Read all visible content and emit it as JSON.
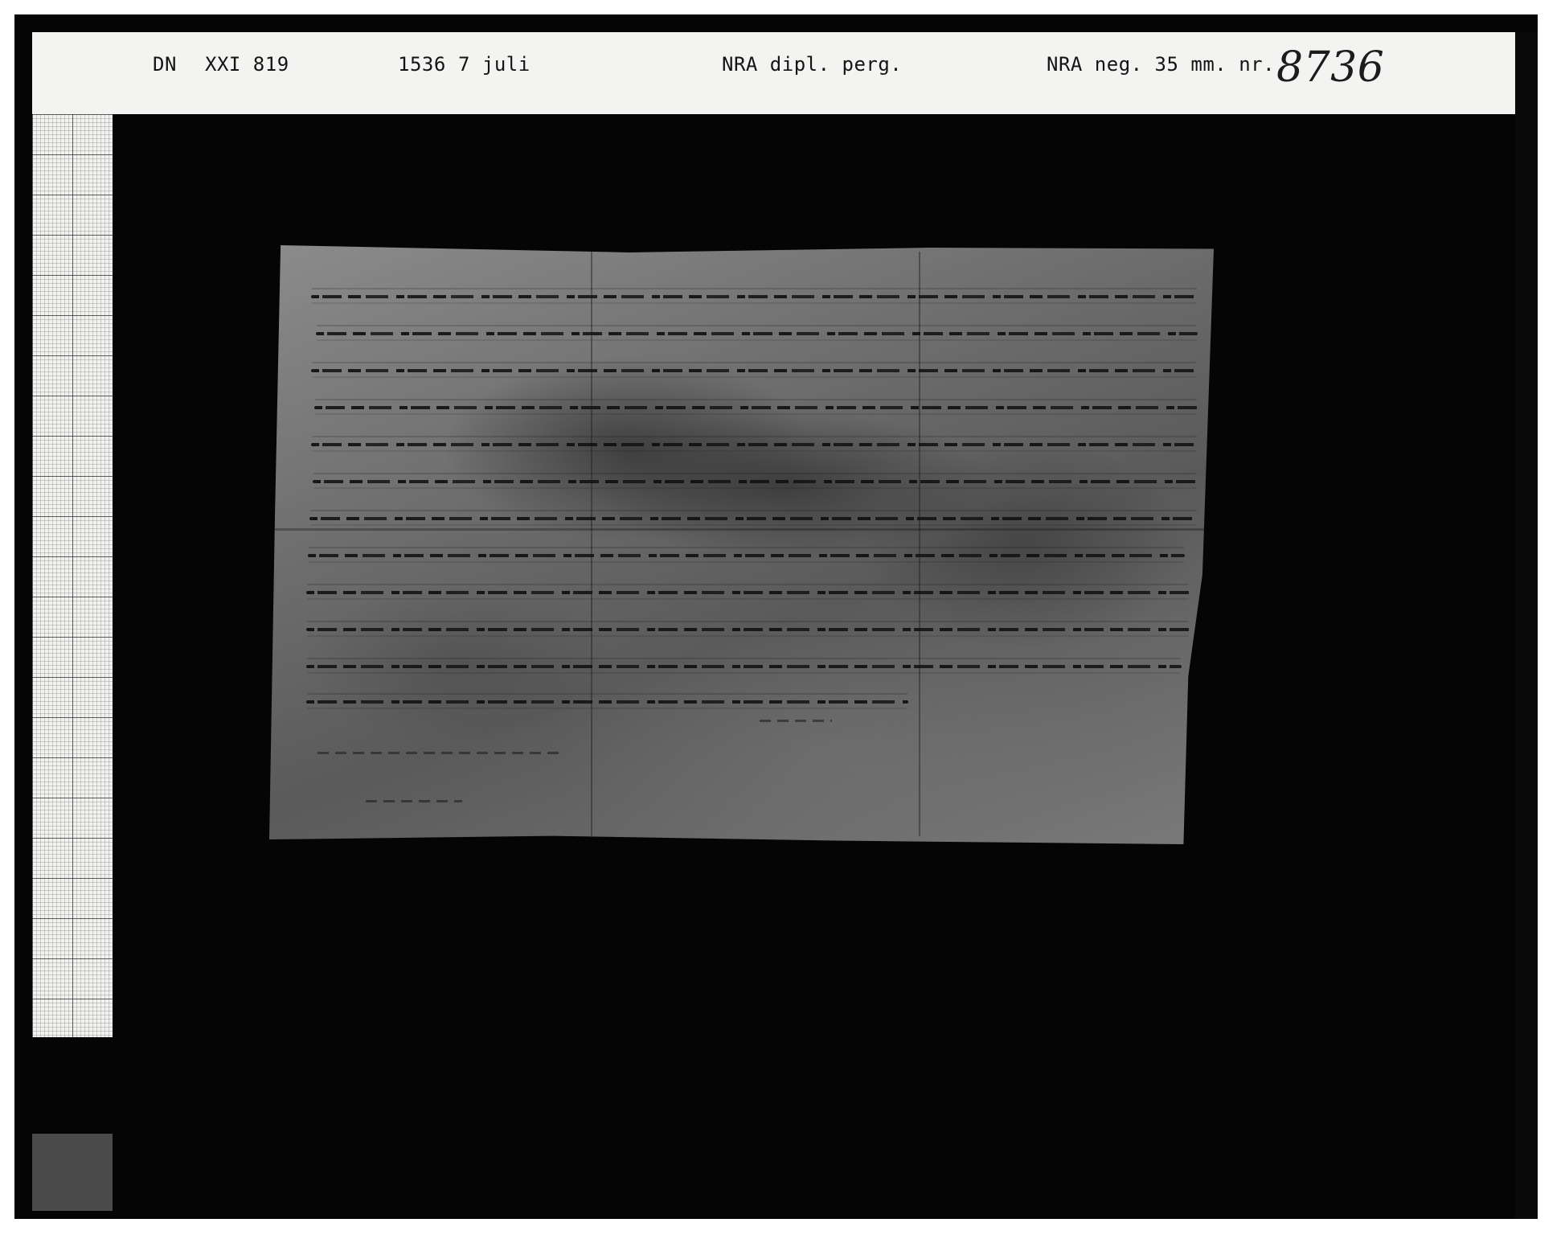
{
  "label": {
    "series": "DN",
    "volume": "XXI 819",
    "year": "1536",
    "date": "7 juli",
    "archive": "NRA dipl. perg.",
    "negative": "NRA neg. 35 mm. nr.",
    "negative_number": "8736"
  },
  "icons": {
    "scale": "mm-graph-paper-scale",
    "document": "handwritten-parchment-charter"
  },
  "colors": {
    "mat": "#050505",
    "label_strip": "#f3f3f1",
    "parchment": "#6d6d6d",
    "ink": "#141414"
  }
}
